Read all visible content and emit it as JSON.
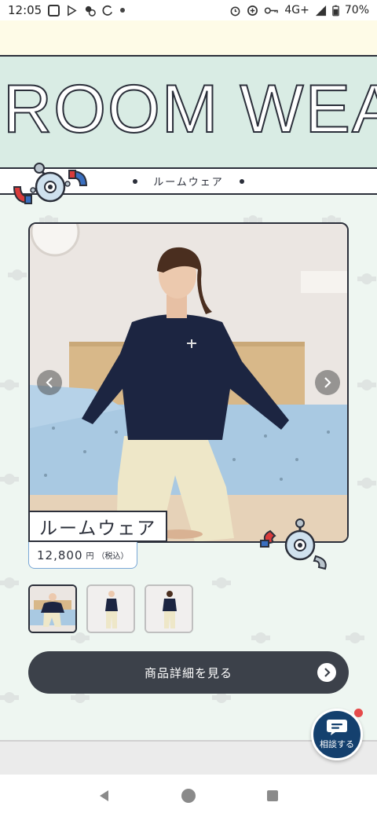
{
  "status_bar": {
    "time": "12:05",
    "network": "4G+",
    "battery": "70%"
  },
  "hero": {
    "title": "ROOM WEA"
  },
  "section": {
    "label": "ルームウェア"
  },
  "product": {
    "name": "ルームウェア",
    "price": "12,800",
    "currency": "円",
    "tax_note": "（税込）",
    "thumbnails": [
      {
        "name": "thumb-1",
        "active": true
      },
      {
        "name": "thumb-2",
        "active": false
      },
      {
        "name": "thumb-3",
        "active": false
      }
    ]
  },
  "actions": {
    "detail_button": "商品詳細を見る",
    "chat_label": "相談する"
  },
  "colors": {
    "accent_dark": "#2b2f3a",
    "button_bg": "#3c414a",
    "chat_bg": "#14406e",
    "badge": "#e64a4a"
  }
}
